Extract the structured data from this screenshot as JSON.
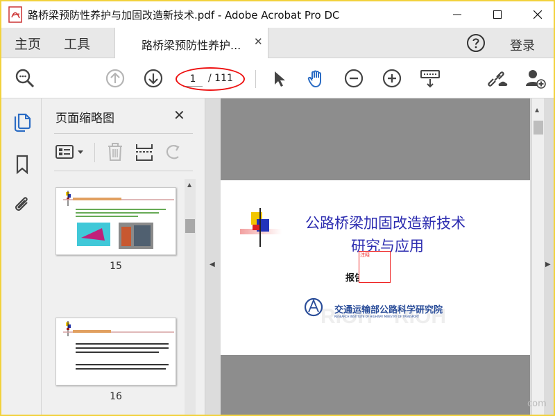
{
  "window": {
    "title": "路桥梁预防性养护与加固改造新技术.pdf - Adobe Acrobat Pro DC",
    "minimize_icon": "minimize-icon",
    "maximize_icon": "maximize-icon",
    "close_icon": "close-icon"
  },
  "tabs": {
    "home": "主页",
    "tools": "工具",
    "document": "路桥梁预防性养护...",
    "document_close": "✕",
    "login": "登录"
  },
  "toolbar": {
    "page_current": "1",
    "page_total": "/ 111",
    "icons": [
      "search-zoom-icon",
      "prev-page-icon",
      "next-page-icon",
      "select-arrow-icon",
      "hand-tool-icon",
      "zoom-out-icon",
      "zoom-in-icon",
      "keyboard-scroll-icon",
      "share-link-icon",
      "add-user-icon"
    ]
  },
  "thumbnails": {
    "title": "页面缩略图",
    "close": "✕",
    "pages": [
      {
        "number": "15"
      },
      {
        "number": "16"
      }
    ]
  },
  "slide": {
    "title_line1": "公路桥梁加固改造新技术",
    "title_line2": "研究与应用",
    "reporter": "报告            荣永",
    "redbox_label": "注释",
    "logo_cn": "交通运输部公路科学研究院",
    "logo_en": "RESEARCH INSTITUTE OF HIGHWAY  MINISTRY OF TRANSPORT"
  },
  "watermark": "com",
  "colors": {
    "accent_blue": "#2b6cc4",
    "annotation_red": "#e11111",
    "slide_title": "#2c2cb0",
    "window_border": "#f2d23c"
  }
}
